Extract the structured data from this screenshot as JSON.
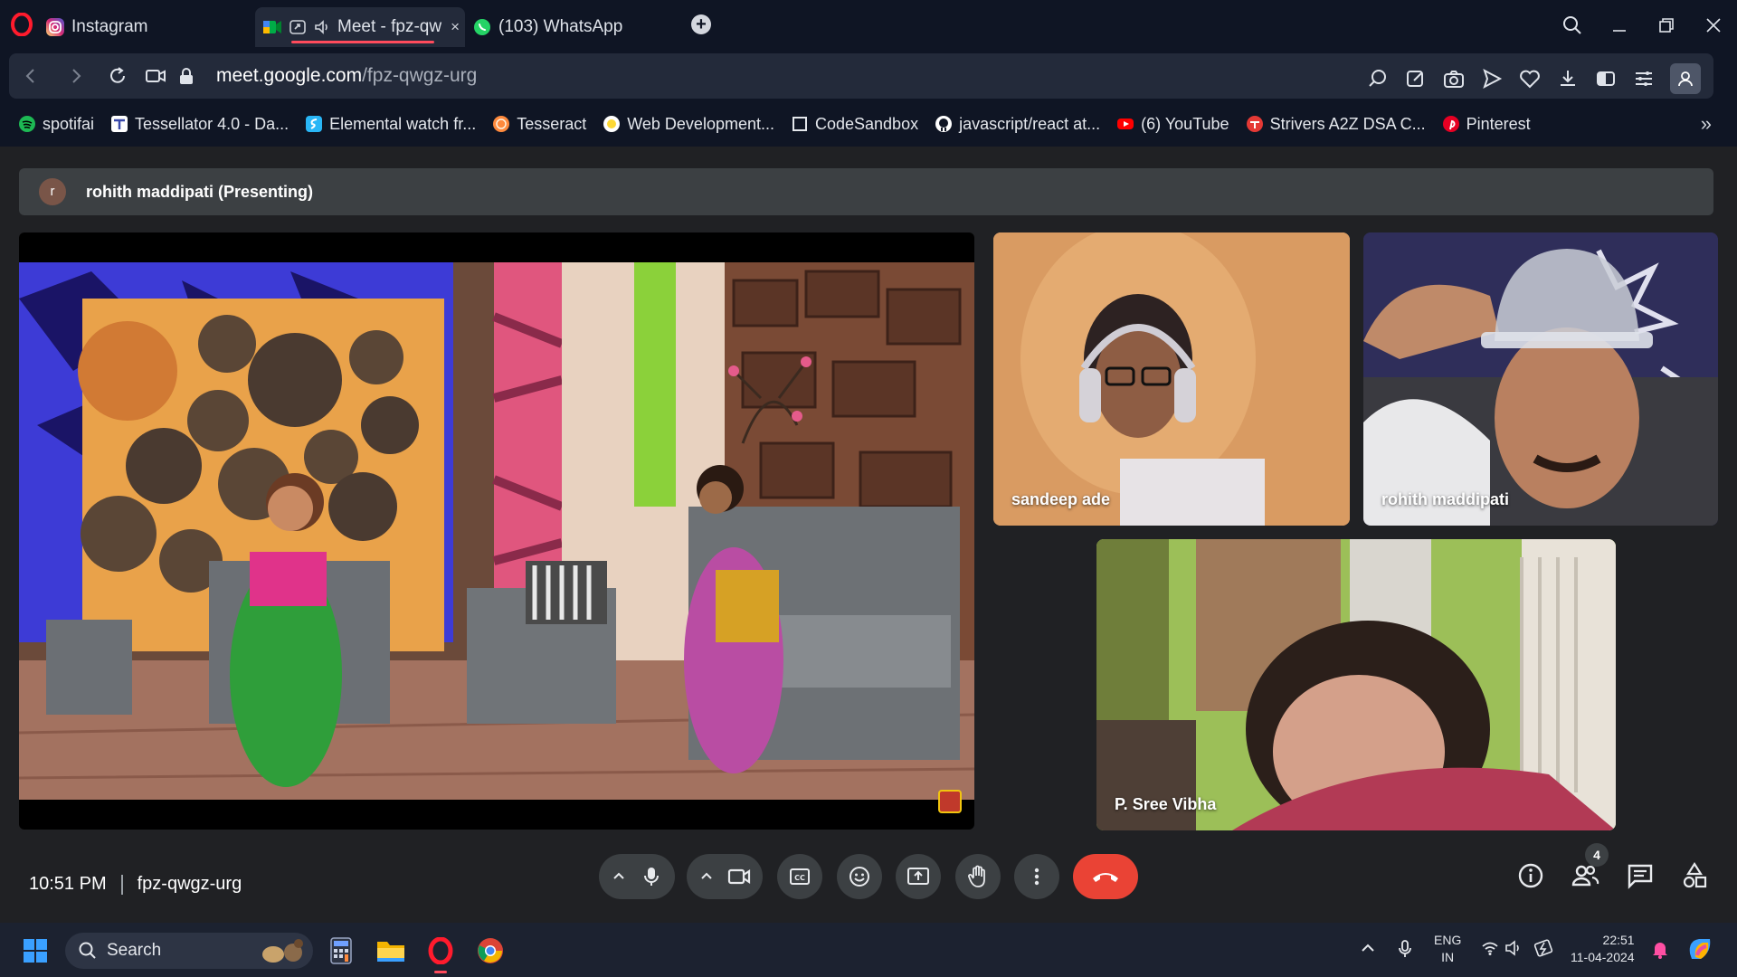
{
  "browser": {
    "tabs": [
      {
        "label": "Instagram",
        "icon": "instagram-icon"
      },
      {
        "label": "Meet - fpz-qw",
        "icon": "google-meet-icon",
        "close": "×"
      },
      {
        "label": "(103) WhatsApp",
        "icon": "whatsapp-icon"
      }
    ],
    "new_tab": "+",
    "url_host": "meet.google.com",
    "url_path": "/fpz-qwgz-urg",
    "bookmarks": [
      {
        "label": "spotifai",
        "color": "#1db954"
      },
      {
        "label": "Tessellator 4.0 - Da...",
        "color": "#ffffff"
      },
      {
        "label": "Elemental watch fr...",
        "color": "#29b6f6"
      },
      {
        "label": "Tesseract",
        "color": "#ff8a3d"
      },
      {
        "label": "Web Development...",
        "color": "#fdd835"
      },
      {
        "label": "CodeSandbox",
        "color": "#0f1524"
      },
      {
        "label": "javascript/react at...",
        "color": "#ffffff"
      },
      {
        "label": "(6) YouTube",
        "color": "#ff0000"
      },
      {
        "label": "Strivers A2Z DSA C...",
        "color": "#e53935"
      },
      {
        "label": "Pinterest",
        "color": "#e60023"
      }
    ],
    "bookmarks_more": "»"
  },
  "meet": {
    "presenting_avatar": "r",
    "presenting_text": "rohith maddipati (Presenting)",
    "participants": [
      {
        "name": "sandeep ade"
      },
      {
        "name": "rohith maddipati"
      },
      {
        "name": "P. Sree Vibha"
      }
    ],
    "time": "10:51 PM",
    "meeting_code": "fpz-qwgz-urg",
    "people_count": "4"
  },
  "taskbar": {
    "search_label": "Search",
    "lang_line1": "ENG",
    "lang_line2": "IN",
    "time": "22:51",
    "date": "11-04-2024"
  },
  "colors": {
    "end_call": "#ea4335",
    "accent": "#ff4b5c"
  }
}
